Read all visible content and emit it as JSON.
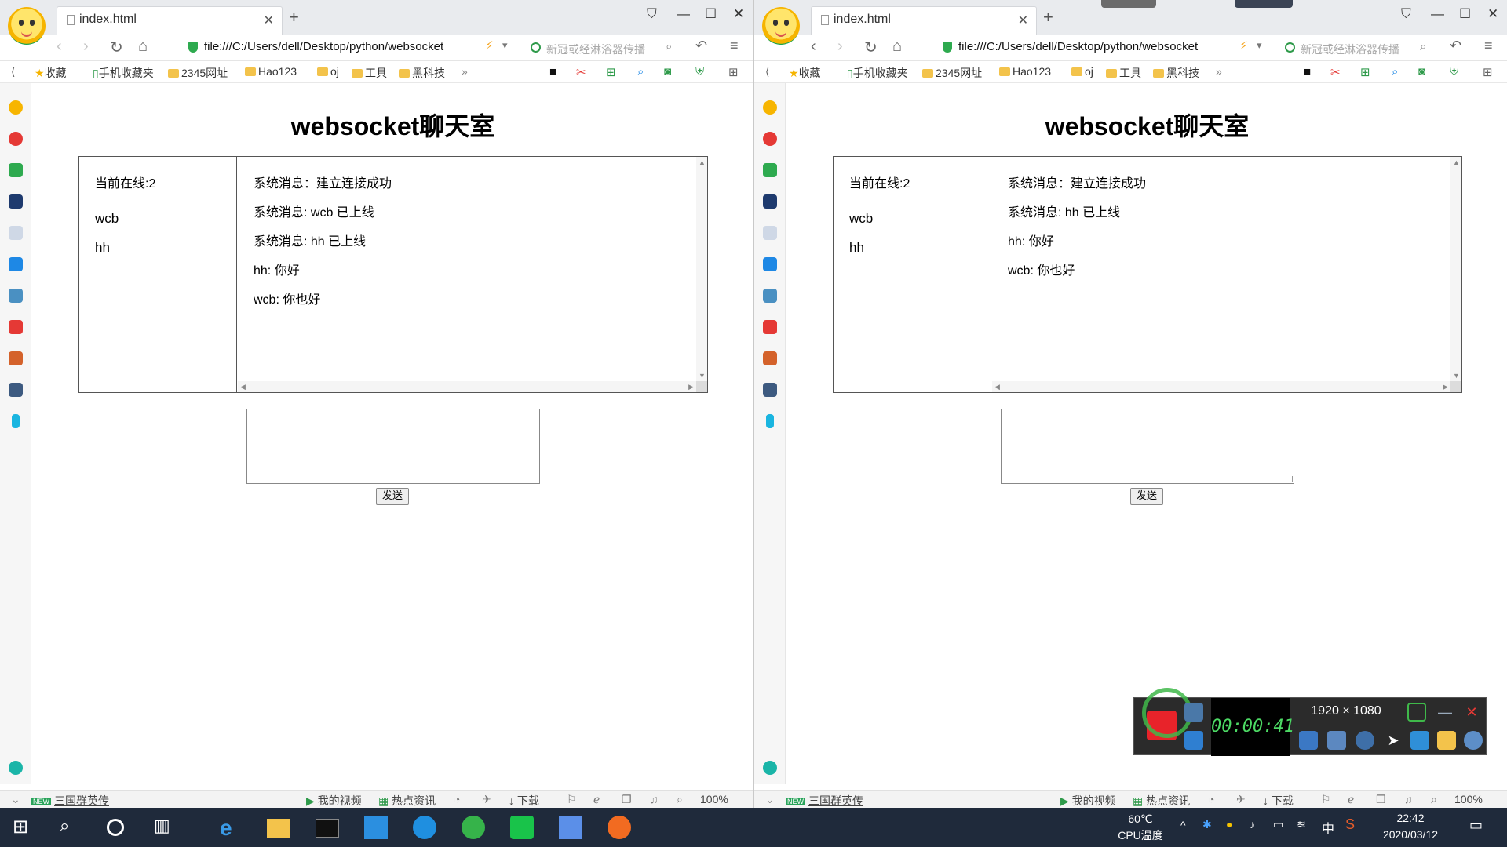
{
  "left_window": {
    "tab": {
      "title": "index.html"
    },
    "address": {
      "url": "file:///C:/Users/dell/Desktop/python/websocket"
    },
    "search": {
      "placeholder": "新冠或经淋浴器传播"
    },
    "bookmarks": [
      "收藏",
      "手机收藏夹",
      "2345网址",
      "Hao123",
      "oj",
      "工具",
      "黑科技"
    ],
    "page": {
      "title": "websocket聊天室",
      "online": "当前在线:2",
      "users": [
        "wcb",
        "hh"
      ],
      "messages": [
        "系统消息：建立连接成功",
        "系统消息: wcb 已上线",
        "系统消息: hh 已上线",
        "hh: 你好",
        "wcb: 你也好"
      ],
      "send_label": "发送"
    },
    "statusbar": {
      "news": "三国群英传",
      "video": "我的视频",
      "hot": "热点资讯",
      "download": "下载",
      "zoom": "100%"
    }
  },
  "right_window": {
    "tab": {
      "title": "index.html"
    },
    "address": {
      "url": "file:///C:/Users/dell/Desktop/python/websocket"
    },
    "search": {
      "placeholder": "新冠或经淋浴器传播"
    },
    "bookmarks": [
      "收藏",
      "手机收藏夹",
      "2345网址",
      "Hao123",
      "oj",
      "工具",
      "黑科技"
    ],
    "page": {
      "title": "websocket聊天室",
      "online": "当前在线:2",
      "users": [
        "wcb",
        "hh"
      ],
      "messages": [
        "系统消息：建立连接成功",
        "系统消息: hh 已上线",
        "hh: 你好",
        "wcb: 你也好"
      ],
      "send_label": "发送"
    },
    "statusbar": {
      "news": "三国群英传",
      "video": "我的视频",
      "hot": "热点资讯",
      "download": "下载",
      "zoom": "100%"
    }
  },
  "recorder": {
    "timer": "00:00:41",
    "resolution": "1920 × 1080"
  },
  "taskbar": {
    "temp": "60℃",
    "temp_label": "CPU温度",
    "ime": "中",
    "time": "22:42",
    "date": "2020/03/12"
  }
}
